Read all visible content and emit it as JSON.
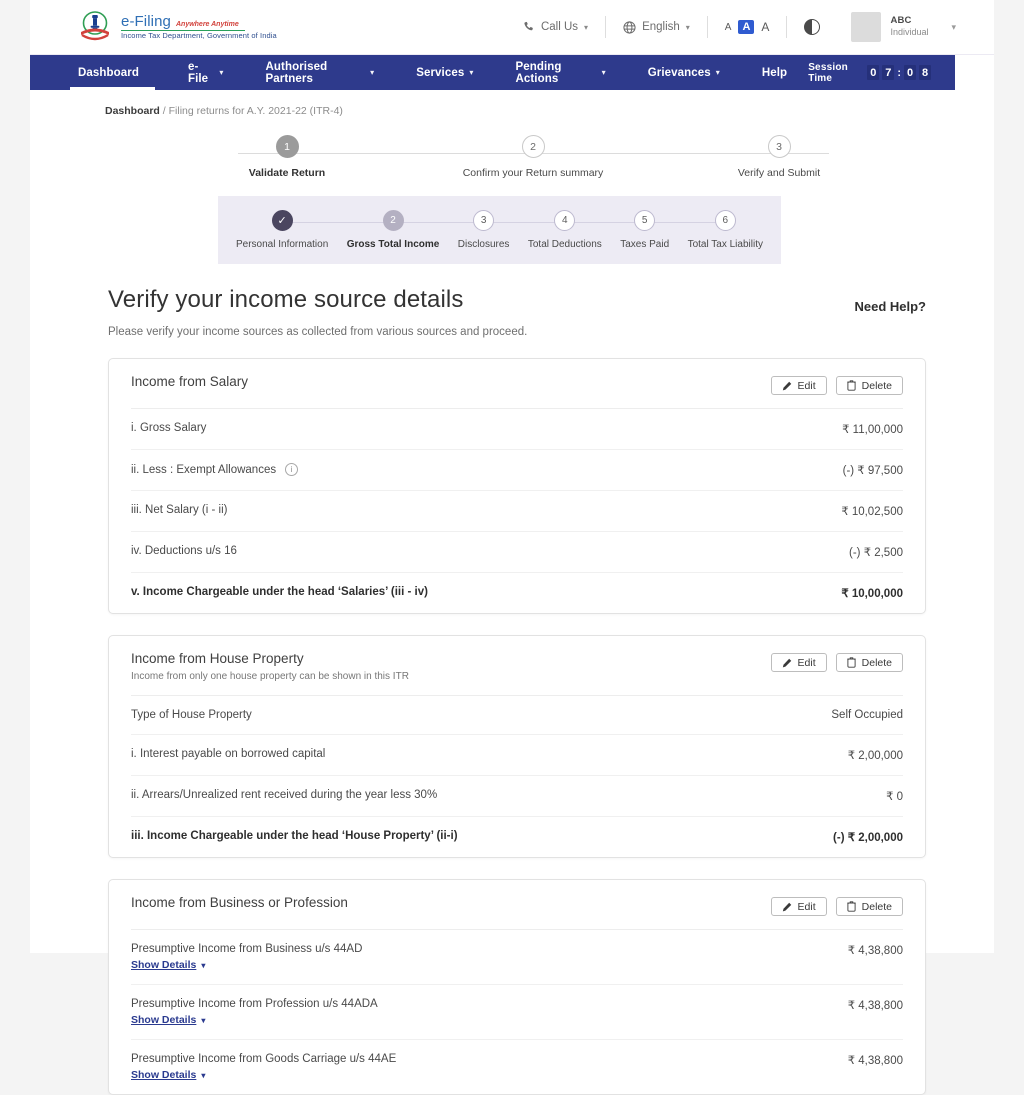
{
  "header": {
    "brand": {
      "name": "e-Filing",
      "tagline": "Anywhere Anytime",
      "department": "Income Tax Department, Government of India",
      "emblem_icon": "india-emblem-icon"
    },
    "utilities": {
      "call_us": "Call Us",
      "call_icon": "phone-icon",
      "language": "English",
      "language_icon": "globe-icon",
      "font_small": "A",
      "font_medium": "A",
      "font_large": "A",
      "contrast_icon": "contrast-icon",
      "profile_name": "ABC",
      "profile_role": "Individual",
      "caret_icon": "chevron-down-icon"
    }
  },
  "nav": {
    "items": [
      {
        "label": "Dashboard",
        "has_caret": false,
        "active": true
      },
      {
        "label": "e-File",
        "has_caret": true,
        "active": false
      },
      {
        "label": "Authorised Partners",
        "has_caret": true,
        "active": false
      },
      {
        "label": "Services",
        "has_caret": true,
        "active": false
      },
      {
        "label": "Pending Actions",
        "has_caret": true,
        "active": false
      },
      {
        "label": "Grievances",
        "has_caret": true,
        "active": false
      },
      {
        "label": "Help",
        "has_caret": false,
        "active": false
      }
    ],
    "session_label": "Session Time",
    "session_digits": [
      "0",
      "7",
      "0",
      "8"
    ],
    "session_separator": ":"
  },
  "breadcrumb": {
    "root": "Dashboard",
    "separator": "/",
    "current": "Filing returns for A.Y. 2021-22 (ITR-4)"
  },
  "stepper": {
    "steps": [
      {
        "number": "1",
        "label": "Validate Return",
        "state": "current"
      },
      {
        "number": "2",
        "label": "Confirm your Return summary",
        "state": "upcoming"
      },
      {
        "number": "3",
        "label": "Verify and Submit",
        "state": "upcoming"
      }
    ]
  },
  "substepper": {
    "steps": [
      {
        "number": "✓",
        "label": "Personal Information",
        "state": "done"
      },
      {
        "number": "2",
        "label": "Gross Total Income",
        "state": "current"
      },
      {
        "number": "3",
        "label": "Disclosures",
        "state": "upcoming"
      },
      {
        "number": "4",
        "label": "Total Deductions",
        "state": "upcoming"
      },
      {
        "number": "5",
        "label": "Taxes Paid",
        "state": "upcoming"
      },
      {
        "number": "6",
        "label": "Total Tax Liability",
        "state": "upcoming"
      }
    ]
  },
  "page": {
    "title": "Verify your income source details",
    "need_help": "Need Help?",
    "subtitle": "Please verify your income sources as collected from various sources and proceed."
  },
  "buttons": {
    "edit": "Edit",
    "delete": "Delete",
    "edit_icon": "pencil-icon",
    "delete_icon": "trash-icon",
    "show_details": "Show Details",
    "show_details_caret": "chevron-down-icon"
  },
  "cards": {
    "salary": {
      "title": "Income from Salary",
      "rows": [
        {
          "label": "i. Gross Salary",
          "value": "₹ 11,00,000",
          "bold": false,
          "info": false
        },
        {
          "label": "ii. Less : Exempt Allowances",
          "value": "(-) ₹ 97,500",
          "bold": false,
          "info": true
        },
        {
          "label": "iii. Net Salary (i - ii)",
          "value": "₹ 10,02,500",
          "bold": false,
          "info": false
        },
        {
          "label": "iv. Deductions u/s 16",
          "value": "(-) ₹ 2,500",
          "bold": false,
          "info": false
        },
        {
          "label": "v. Income Chargeable under the head ‘Salaries’  (iii - iv)",
          "value": "₹ 10,00,000",
          "bold": true,
          "info": false
        }
      ]
    },
    "house_property": {
      "title": "Income from House Property",
      "subtitle": "Income from only one house property can be shown in this ITR",
      "rows": [
        {
          "label": "Type of House Property",
          "value": "Self Occupied",
          "bold": false
        },
        {
          "label": "i. Interest payable on borrowed capital",
          "value": "₹ 2,00,000",
          "bold": false
        },
        {
          "label": "ii. Arrears/Unrealized rent received during the year less 30%",
          "value": "₹ 0",
          "bold": false
        },
        {
          "label": "iii. Income Chargeable under the head ‘House Property’ (ii-i)",
          "value": "(-) ₹ 2,00,000",
          "bold": true
        }
      ]
    },
    "business": {
      "title": "Income from Business or Profession",
      "rows": [
        {
          "label": "Presumptive Income from Business u/s 44AD",
          "value": "₹ 4,38,800"
        },
        {
          "label": "Presumptive Income from Profession u/s 44ADA",
          "value": "₹ 4,38,800"
        },
        {
          "label": "Presumptive Income from Goods Carriage u/s 44AE",
          "value": "₹ 4,38,800"
        }
      ]
    }
  },
  "colors": {
    "nav_bg": "#2e3a8c",
    "substep_bg": "#edebf4",
    "link": "#2a3a8f",
    "accent_blue": "#2f5bd0"
  }
}
